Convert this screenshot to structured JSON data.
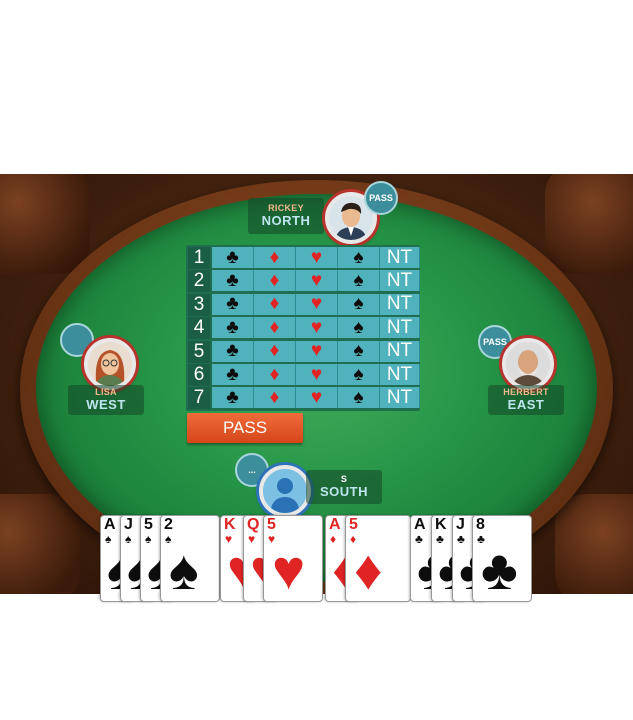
{
  "players": {
    "north": {
      "name": "RICKEY",
      "seat": "NORTH",
      "bid": "PASS"
    },
    "west": {
      "name": "LISA",
      "seat": "WEST",
      "bid": ""
    },
    "east": {
      "name": "HERBERT",
      "seat": "EAST",
      "bid": "PASS"
    },
    "south": {
      "name": "S",
      "seat": "SOUTH",
      "bid": "..."
    }
  },
  "bidding": {
    "levels": [
      "1",
      "2",
      "3",
      "4",
      "5",
      "6",
      "7"
    ],
    "suits": [
      {
        "symbol": "♣",
        "color": "#0d0d0d"
      },
      {
        "symbol": "♦",
        "color": "#e02424"
      },
      {
        "symbol": "♥",
        "color": "#e02424"
      },
      {
        "symbol": "♠",
        "color": "#0d0d0d"
      },
      {
        "symbol": "NT",
        "color": "#ffffff"
      }
    ],
    "pass_label": "PASS"
  },
  "hand": [
    {
      "rank": "A",
      "suit": "♠",
      "color": "#0d0d0d"
    },
    {
      "rank": "J",
      "suit": "♠",
      "color": "#0d0d0d"
    },
    {
      "rank": "5",
      "suit": "♠",
      "color": "#0d0d0d"
    },
    {
      "rank": "2",
      "suit": "♠",
      "color": "#0d0d0d"
    },
    {
      "rank": "K",
      "suit": "♥",
      "color": "#e02424"
    },
    {
      "rank": "Q",
      "suit": "♥",
      "color": "#e02424"
    },
    {
      "rank": "5",
      "suit": "♥",
      "color": "#e02424"
    },
    {
      "rank": "A",
      "suit": "♦",
      "color": "#e02424"
    },
    {
      "rank": "5",
      "suit": "♦",
      "color": "#e02424"
    },
    {
      "rank": "A",
      "suit": "♣",
      "color": "#0d0d0d"
    },
    {
      "rank": "K",
      "suit": "♣",
      "color": "#0d0d0d"
    },
    {
      "rank": "J",
      "suit": "♣",
      "color": "#0d0d0d"
    },
    {
      "rank": "8",
      "suit": "♣",
      "color": "#0d0d0d"
    }
  ]
}
